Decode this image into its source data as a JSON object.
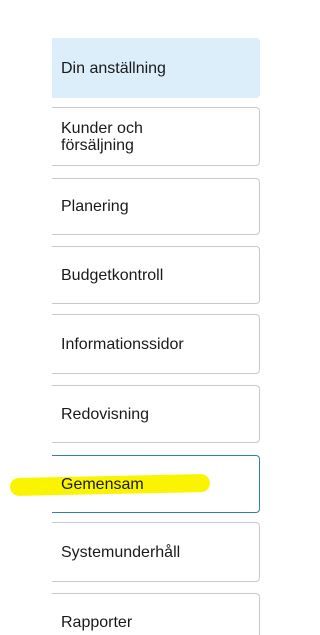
{
  "nav": {
    "items": [
      {
        "label": "Din anställning",
        "state": "active"
      },
      {
        "label": "Kunder och\nförsäljning",
        "state": "default"
      },
      {
        "label": "Planering",
        "state": "default"
      },
      {
        "label": "Budgetkontroll",
        "state": "default"
      },
      {
        "label": "Informationssidor",
        "state": "default"
      },
      {
        "label": "Redovisning",
        "state": "default"
      },
      {
        "label": "Gemensam",
        "state": "focused"
      },
      {
        "label": "Systemunderhåll",
        "state": "default"
      },
      {
        "label": "Rapporter",
        "state": "default"
      }
    ]
  },
  "colors": {
    "active_background": "#dbeef9",
    "focused_border": "#2f7fb0",
    "item_border": "#c9c9c9",
    "highlighter": "#fbf400"
  }
}
